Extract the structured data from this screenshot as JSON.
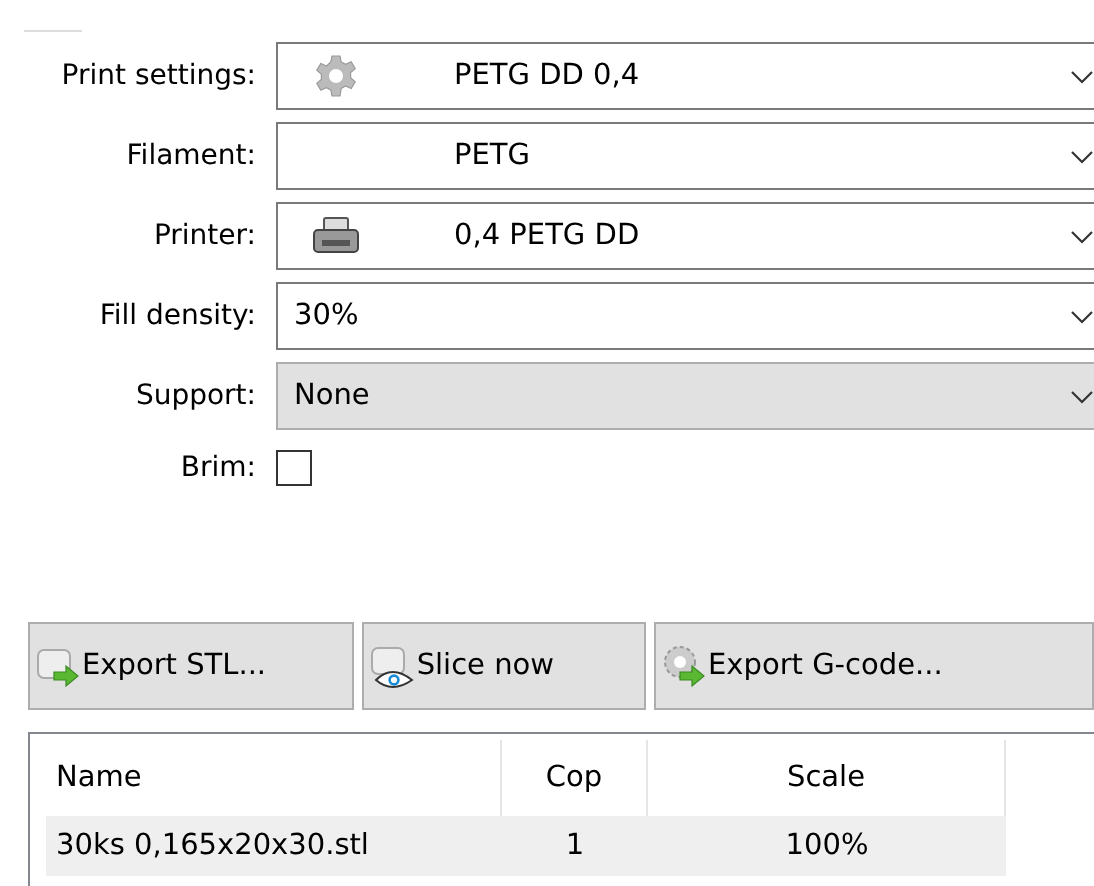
{
  "settings": [
    {
      "label": "Print settings:",
      "kind": "preset",
      "value": "PETG DD 0,4"
    },
    {
      "label": "Filament:",
      "kind": "preset",
      "value": "PETG"
    },
    {
      "label": "Printer:",
      "kind": "preset",
      "value": "0,4 PETG DD"
    },
    {
      "label": "Fill density:",
      "kind": "editable",
      "value": "30%"
    },
    {
      "label": "Support:",
      "kind": "choice",
      "value": "None"
    },
    {
      "label": "Brim:",
      "kind": "checkbox",
      "checked": false
    }
  ],
  "buttons": [
    "Export STL...",
    "Slice now",
    "Export G-code..."
  ],
  "table": {
    "columns": [
      "Name",
      "Cop",
      "Scale"
    ],
    "rows": [
      {
        "cells": [
          "30ks 0,165x20x30.stl",
          "1",
          "100%"
        ],
        "selected": true
      }
    ]
  }
}
